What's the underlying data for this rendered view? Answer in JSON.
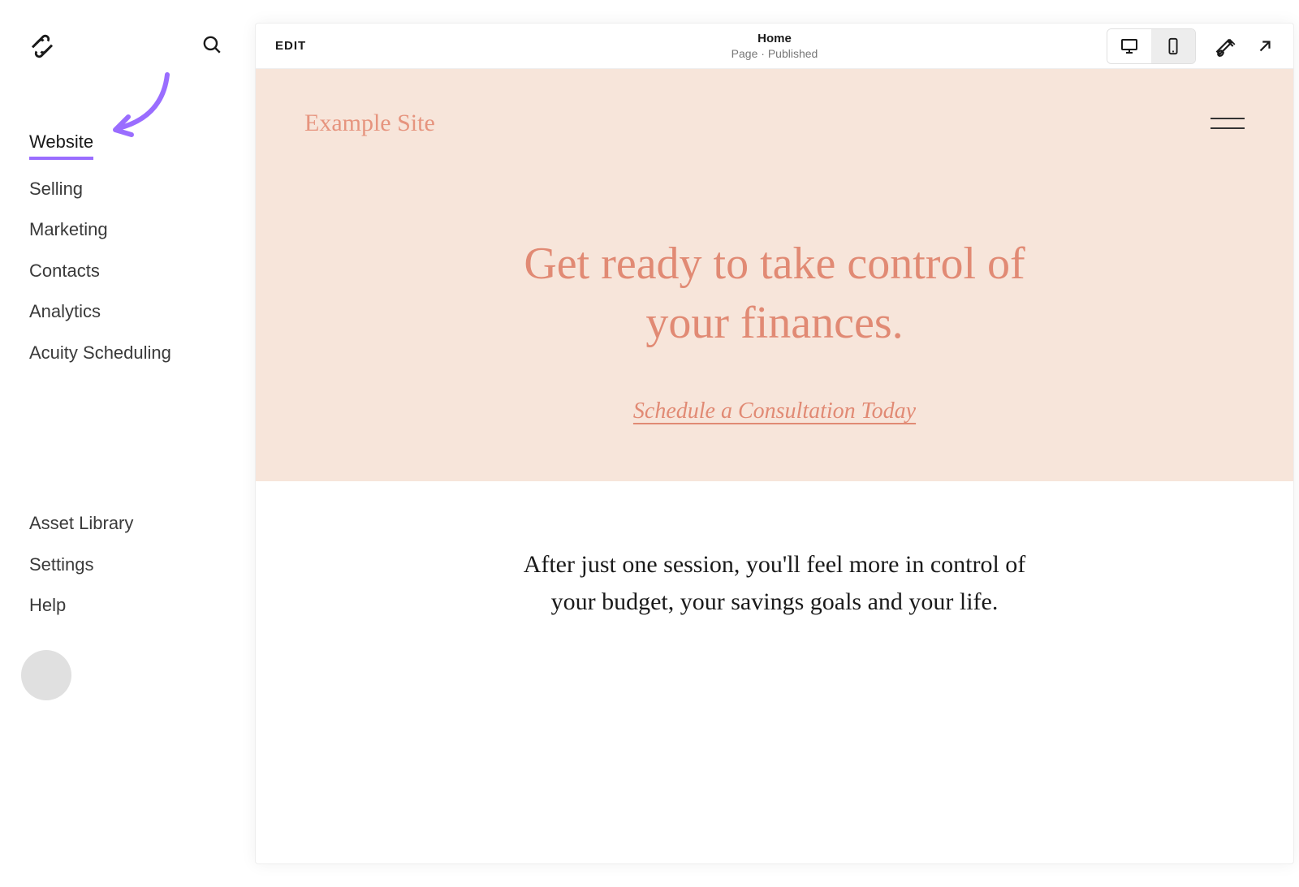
{
  "sidebar": {
    "nav_primary": [
      {
        "label": "Website",
        "active": true
      },
      {
        "label": "Selling",
        "active": false
      },
      {
        "label": "Marketing",
        "active": false
      },
      {
        "label": "Contacts",
        "active": false
      },
      {
        "label": "Analytics",
        "active": false
      },
      {
        "label": "Acuity Scheduling",
        "active": false
      }
    ],
    "nav_secondary": [
      {
        "label": "Asset Library"
      },
      {
        "label": "Settings"
      },
      {
        "label": "Help"
      }
    ]
  },
  "topbar": {
    "edit_label": "EDIT",
    "page_title": "Home",
    "page_subtitle": "Page · Published"
  },
  "preview": {
    "site_title": "Example Site",
    "hero_heading": "Get ready to take control of your finances.",
    "hero_cta": "Schedule a Consultation Today",
    "body_copy": "After just one session, you'll feel more in control of your budget, your savings goals and your life."
  },
  "colors": {
    "accent_purple": "#9a6dff",
    "hero_bg": "#f7e5da",
    "hero_text": "#e18a74"
  }
}
